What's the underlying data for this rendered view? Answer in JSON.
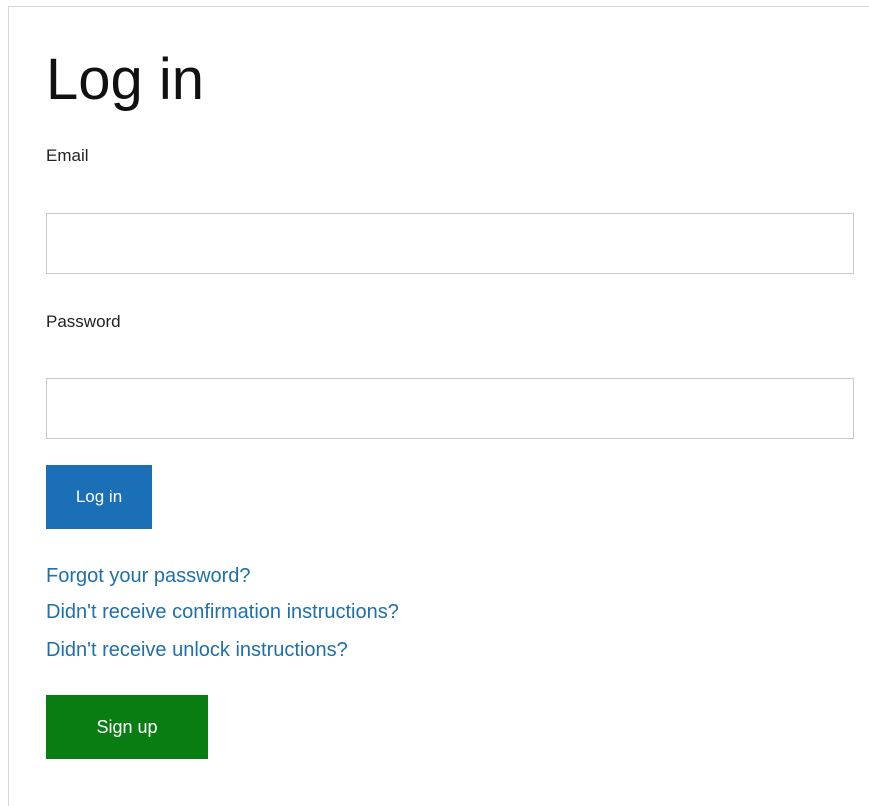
{
  "form": {
    "title": "Log in",
    "email": {
      "label": "Email",
      "value": "",
      "placeholder": ""
    },
    "password": {
      "label": "Password",
      "value": "",
      "placeholder": ""
    },
    "login_button_label": "Log in",
    "links": {
      "forgot_password": "Forgot your password?",
      "confirmation": "Didn't receive confirmation instructions?",
      "unlock": "Didn't receive unlock instructions?"
    },
    "signup_button_label": "Sign up"
  },
  "colors": {
    "primary_button": "#1b6fb6",
    "signup_button": "#0a7d12",
    "link": "#1f6fa8"
  }
}
